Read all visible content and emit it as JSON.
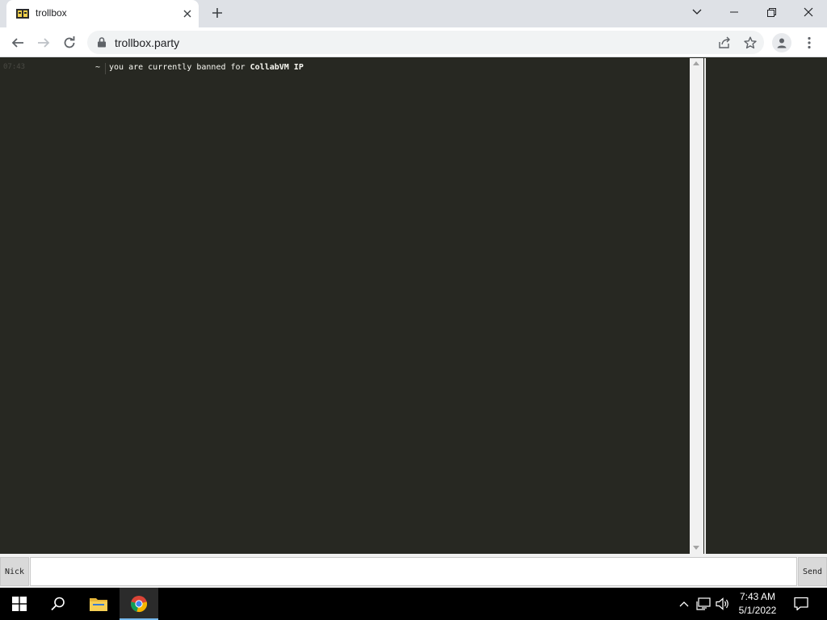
{
  "browser": {
    "tab": {
      "title": "trollbox",
      "favicon": "trollbox-favicon-icon",
      "close_icon": "close-icon"
    },
    "new_tab_icon": "plus-icon",
    "window_controls": [
      "chevron-down-icon",
      "minimize-icon",
      "restore-icon",
      "close-icon"
    ],
    "toolbar": {
      "back_icon": "arrow-left-icon",
      "forward_icon": "arrow-right-icon",
      "reload_icon": "reload-icon",
      "url": "trollbox.party",
      "lock_icon": "lock-icon",
      "share_icon": "share-icon",
      "bookmark_icon": "star-icon",
      "profile_icon": "person-icon",
      "menu_icon": "kebab-menu-icon"
    }
  },
  "chat": {
    "messages": [
      {
        "time": "07:43",
        "nick": "~",
        "text_prefix": "you are currently banned for ",
        "text_bold": "CollabVM IP"
      }
    ]
  },
  "input_bar": {
    "nick_label": "Nick",
    "send_label": "Send",
    "message_value": ""
  },
  "taskbar": {
    "start_icon": "windows-logo-icon",
    "search_icon": "search-icon",
    "explorer_icon": "folder-icon",
    "chrome_icon": "chrome-icon",
    "tray": [
      "chevron-up-icon",
      "network-icon",
      "volume-icon"
    ],
    "time": "7:43 AM",
    "date": "5/1/2022",
    "notification_icon": "notification-icon"
  },
  "colors": {
    "page_bg": "#272822",
    "text": "#f8f8f2",
    "taskbar_bg": "#000000",
    "chrome_tab_bg": "#dee1e6",
    "taskbar_accent": "#76b9ed"
  }
}
